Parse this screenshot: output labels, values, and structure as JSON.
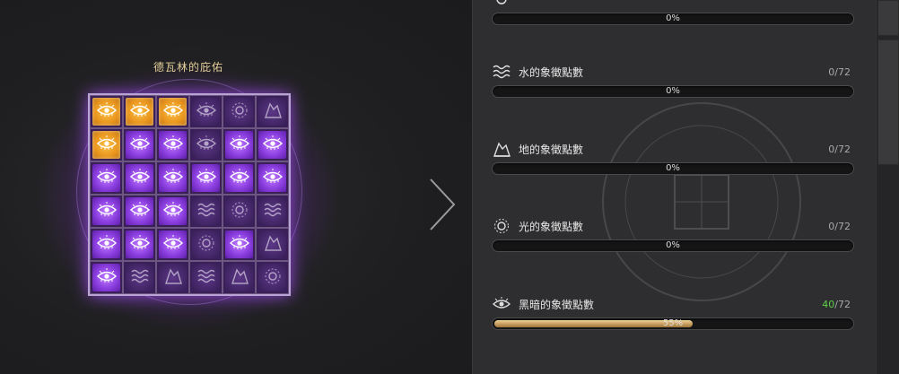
{
  "board": {
    "title": "德瓦林的庇佑",
    "cells": [
      [
        "gold",
        "gold",
        "gold",
        "dim",
        "dim",
        "dim"
      ],
      [
        "gold",
        "bright",
        "bright",
        "dim",
        "bright",
        "bright"
      ],
      [
        "bright",
        "bright",
        "bright",
        "bright",
        "bright",
        "bright"
      ],
      [
        "bright",
        "bright",
        "bright",
        "dim",
        "dim",
        "dim"
      ],
      [
        "bright",
        "bright",
        "bright",
        "dim",
        "bright",
        "dim"
      ],
      [
        "bright",
        "dim",
        "dim",
        "dim",
        "dim",
        "dim"
      ]
    ],
    "icons": [
      [
        "dark",
        "dark",
        "dark",
        "dark",
        "light",
        "earth"
      ],
      [
        "dark",
        "dark",
        "dark",
        "dark",
        "dark",
        "dark"
      ],
      [
        "dark",
        "dark",
        "dark",
        "dark",
        "dark",
        "dark"
      ],
      [
        "dark",
        "dark",
        "dark",
        "water",
        "light",
        "water"
      ],
      [
        "dark",
        "dark",
        "dark",
        "light",
        "dark",
        "earth"
      ],
      [
        "dark",
        "water",
        "earth",
        "water",
        "earth",
        "light"
      ]
    ]
  },
  "stats": [
    {
      "id": "top",
      "label": "",
      "count_current": "",
      "count_total": "",
      "progress_text": "0%",
      "progress": 0,
      "icon": "light-icon"
    },
    {
      "id": "water",
      "label": "水的象徵點數",
      "count_current": "0",
      "count_total": "/72",
      "progress_text": "0%",
      "progress": 0,
      "icon": "water-icon"
    },
    {
      "id": "earth",
      "label": "地的象徵點數",
      "count_current": "0",
      "count_total": "/72",
      "progress_text": "0%",
      "progress": 0,
      "icon": "earth-icon"
    },
    {
      "id": "light",
      "label": "光的象徵點數",
      "count_current": "0",
      "count_total": "/72",
      "progress_text": "0%",
      "progress": 0,
      "icon": "light-icon"
    },
    {
      "id": "dark",
      "label": "黑暗的象徵點數",
      "count_current": "40",
      "count_total": "/72",
      "progress_text": "55%",
      "progress": 0.55,
      "icon": "dark-icon"
    }
  ],
  "colors": {
    "gold": "#e8941c",
    "purple": "#8c3fe0",
    "active_count": "#5ed146"
  }
}
